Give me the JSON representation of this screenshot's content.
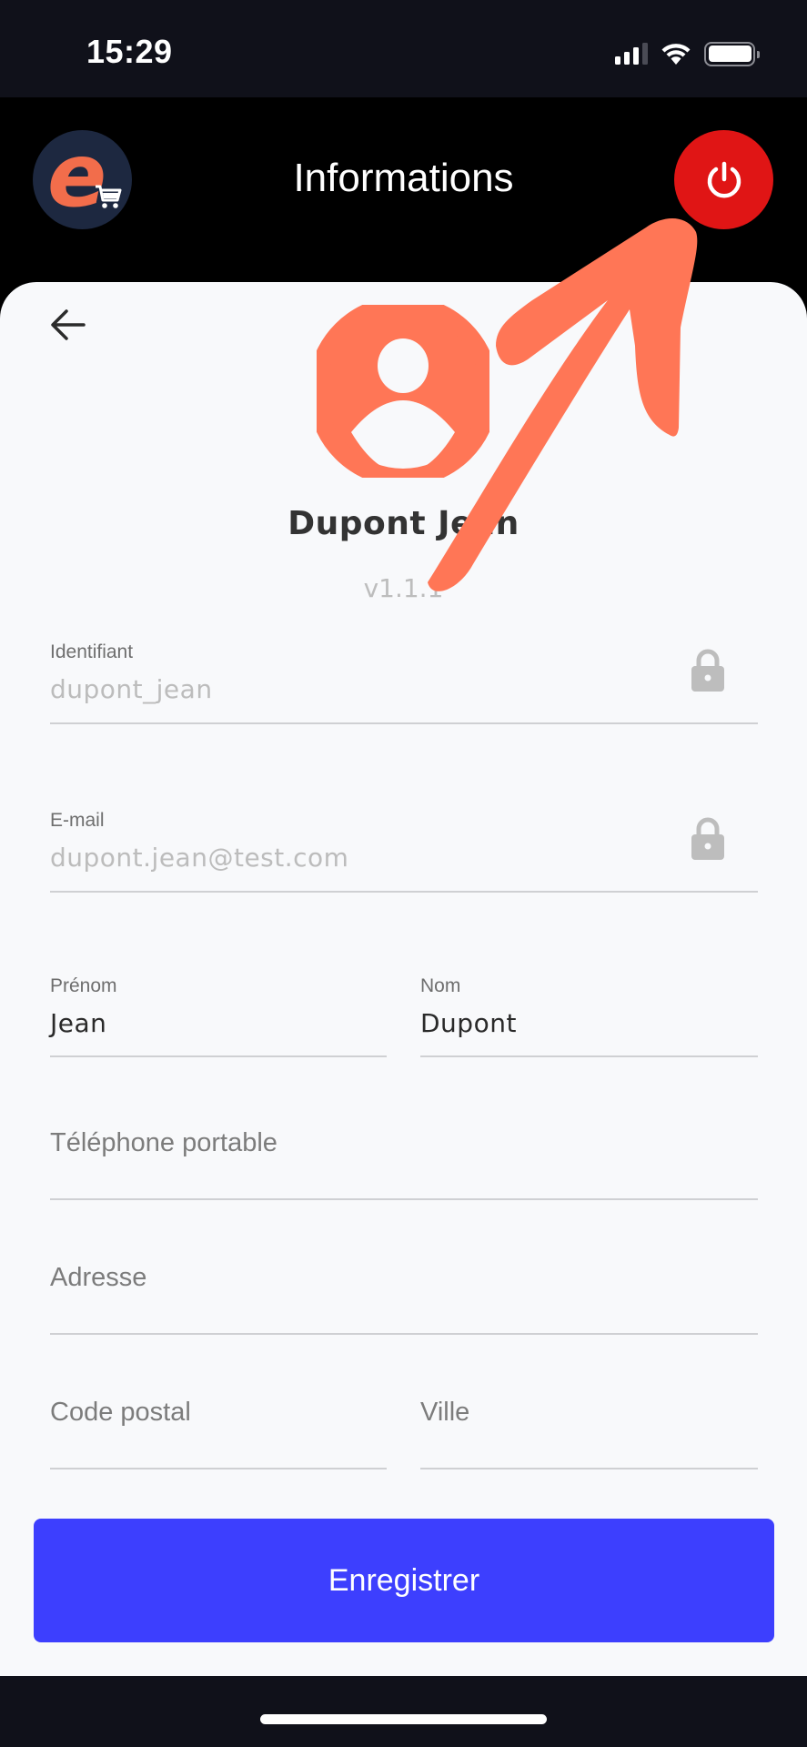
{
  "status_bar": {
    "time": "15:29",
    "signal_bars_active": 3,
    "signal_bars_total": 4,
    "wifi_icon": "wifi-icon",
    "battery_icon": "battery-full-icon"
  },
  "app_bar": {
    "logo_letter": "e",
    "logo_icon": "shopping-cart-icon",
    "title": "Informations",
    "logout_icon": "power-icon"
  },
  "profile": {
    "back_icon": "arrow-left-icon",
    "avatar_icon": "user-circle-icon",
    "name": "Dupont Jean",
    "version": "v1.1.1"
  },
  "form": {
    "identifiant": {
      "label": "Identifiant",
      "value": "dupont_jean",
      "locked": true
    },
    "email": {
      "label": "E-mail",
      "value": "dupont.jean@test.com",
      "locked": true
    },
    "prenom": {
      "label": "Prénom",
      "value": "Jean"
    },
    "nom": {
      "label": "Nom",
      "value": "Dupont"
    },
    "telephone": {
      "placeholder": "Téléphone portable",
      "value": ""
    },
    "adresse": {
      "placeholder": "Adresse",
      "value": ""
    },
    "code_postal": {
      "placeholder": "Code postal",
      "value": ""
    },
    "ville": {
      "placeholder": "Ville",
      "value": ""
    }
  },
  "actions": {
    "save_label": "Enregistrer"
  },
  "colors": {
    "accent_primary": "#3d3ffe",
    "logout_red": "#e01515",
    "brand_orange": "#f26d4b",
    "avatar_orange": "#ff7656",
    "annotation_arrow": "#ff7656",
    "logo_bg": "#1d2840"
  },
  "annotation": {
    "type": "arrow",
    "points_to": "logout-button"
  }
}
